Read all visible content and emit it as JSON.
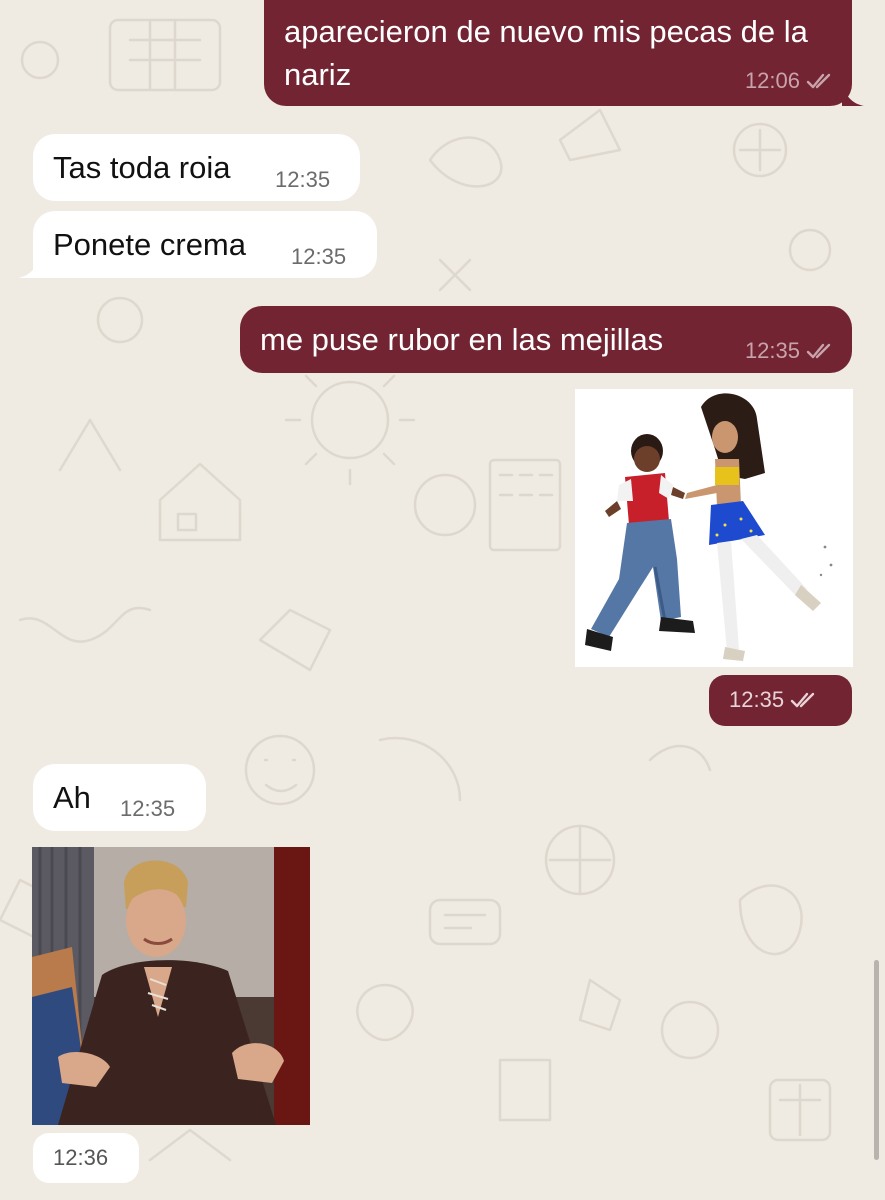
{
  "colors": {
    "wallpaper": "#efeae2",
    "outgoing_bubble": "#722433",
    "incoming_bubble": "#ffffff",
    "outgoing_meta": "#c9a3ab",
    "incoming_meta": "#6b6b6b"
  },
  "messages": [
    {
      "direction": "outgoing",
      "type": "text",
      "text": "aparecieron de nuevo mis pecas de la nariz",
      "time": "12:06",
      "status": "read-double-check-icon"
    },
    {
      "direction": "incoming",
      "type": "text",
      "text": "Tas toda roia",
      "time": "12:35"
    },
    {
      "direction": "incoming",
      "type": "text",
      "text": "Ponete crema",
      "time": "12:35"
    },
    {
      "direction": "outgoing",
      "type": "text",
      "text": "me puse rubor en las mejillas",
      "time": "12:35",
      "status": "read-double-check-icon"
    },
    {
      "direction": "outgoing",
      "type": "sticker",
      "media": "dancing-couple-sticker",
      "time": "12:35",
      "status": "read-double-check-icon"
    },
    {
      "direction": "incoming",
      "type": "text",
      "text": "Ah",
      "time": "12:35"
    },
    {
      "direction": "incoming",
      "type": "image",
      "media": "smiling-man-gif",
      "time": "12:36"
    }
  ]
}
